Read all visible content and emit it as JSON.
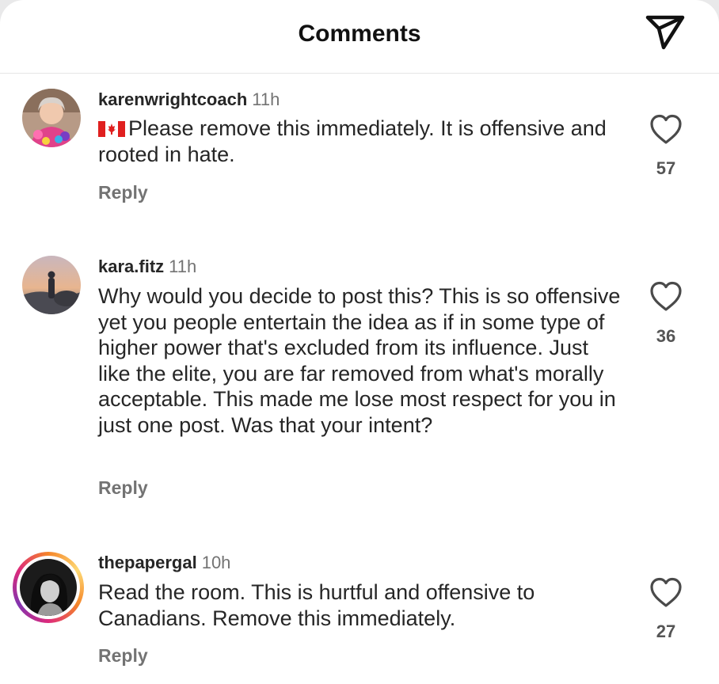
{
  "header": {
    "title": "Comments",
    "share_icon": "paper-plane-icon"
  },
  "comments": [
    {
      "username": "karenwrightcoach",
      "time": "11h",
      "flag_icon": "canada-flag-icon",
      "text": "Please remove this immediately. It is offensive and rooted in hate.",
      "reply_label": "Reply",
      "likes": "57"
    },
    {
      "username": "kara.fitz",
      "time": "11h",
      "text": "Why would you decide to post this? This is so offensive yet you people entertain the idea as if in some type of higher power that's excluded from its influence.  Just like the elite, you are far removed from what's morally acceptable. This made me lose most respect for you in just one post. Was that your intent?",
      "reply_label": "Reply",
      "likes": "36"
    },
    {
      "username": "thepapergal",
      "time": "10h",
      "text": "Read the room. This is hurtful and offensive to Canadians. Remove this immediately.",
      "reply_label": "Reply",
      "likes": "27",
      "has_story_ring": true
    }
  ],
  "colors": {
    "text": "#262626",
    "secondary": "#737373",
    "background": "#ffffff"
  }
}
